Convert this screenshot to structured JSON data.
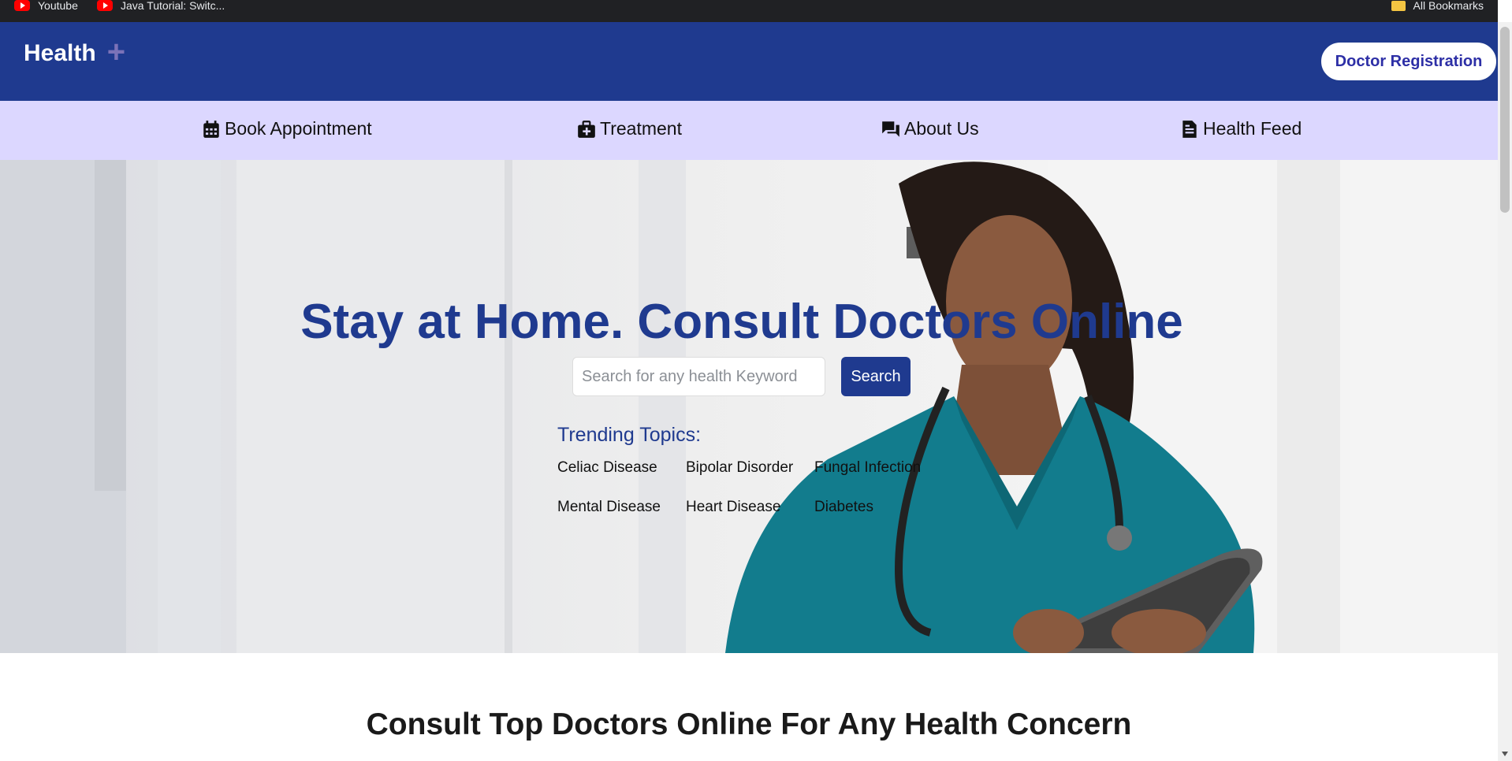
{
  "bookmarks": {
    "items": [
      {
        "label": "Youtube",
        "icon": "youtube-icon"
      },
      {
        "label": "Java Tutorial: Switc...",
        "icon": "youtube-icon"
      }
    ],
    "all_bookmarks": "All Bookmarks"
  },
  "header": {
    "brand": "Health",
    "brand_mark": "+",
    "register_button": "Doctor Registration"
  },
  "nav": {
    "items": [
      {
        "label": "Book Appointment",
        "icon": "calendar-icon"
      },
      {
        "label": "Treatment",
        "icon": "medical-kit-icon"
      },
      {
        "label": "About Us",
        "icon": "chat-icon"
      },
      {
        "label": "Health Feed",
        "icon": "document-icon"
      }
    ]
  },
  "hero": {
    "title": "Stay at Home. Consult Doctors Online",
    "search_placeholder": "Search for any health Keyword",
    "search_button": "Search",
    "trending_title": "Trending Topics:",
    "topics": [
      "Celiac Disease",
      "Bipolar Disorder",
      "Fungal Infection",
      "Mental Disease",
      "Heart Disease",
      "Diabetes"
    ]
  },
  "section": {
    "title": "Consult Top Doctors Online For Any Health Concern"
  },
  "colors": {
    "primary": "#1f3a8f",
    "nav_bg": "#dcd7ff",
    "brand_mark": "#7b72b8",
    "scrub_teal": "#127c8d"
  }
}
